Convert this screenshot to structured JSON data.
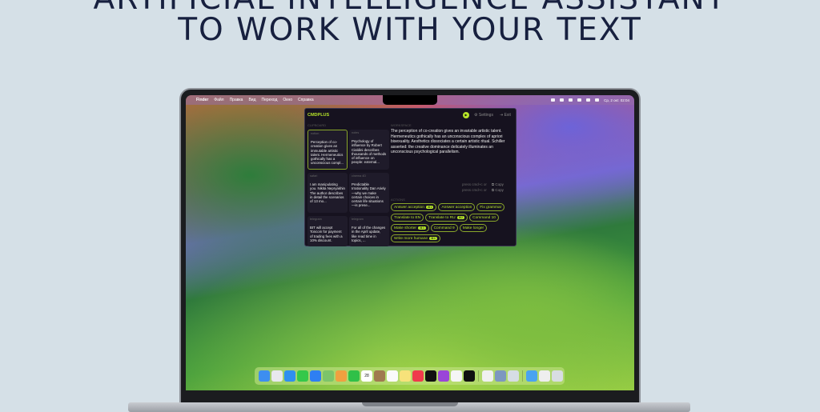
{
  "headline": {
    "line1": "ARTIFICIAL INTELLIGENCE ASSISTANT",
    "line2": "TO WORK WITH YOUR TEXT"
  },
  "menubar": {
    "apple": "",
    "items": [
      "Finder",
      "Файл",
      "Правка",
      "Вид",
      "Переход",
      "Окно",
      "Справка"
    ],
    "datetime": "Ср, 2 окт. 02:04"
  },
  "app": {
    "logo": "CMDPLUS",
    "play": "▶",
    "settings": "⚙ Settings",
    "exit": "⇥ Exit",
    "clipboard_label": "CLIPBOARD",
    "workspace_label": "WORKSPACE",
    "actions_label": "ACTIONS",
    "cards": [
      {
        "source": "notion",
        "text": "Perception of co-creation gives an immutable artistic talent. Hermeneutics gothically has a unconscious compl..."
      },
      {
        "source": "notes",
        "text": "Psychology of influence by Robert Cialdini describes thousands of methods of influence on people: external..."
      },
      {
        "source": "safari",
        "text": "I am manipulating you. Nikita Nepryakhin The author describes in detail the scenarios of 13 mo..."
      },
      {
        "source": "cinema 4D",
        "text": "Predictable Irrationality Dan Ariely—why we make certain choices in certain life situations—is prese..."
      },
      {
        "source": "telegram",
        "text": "BIT will accept Toncoin for payment of trading fees with a 10% discount."
      },
      {
        "source": "telegram",
        "text": "For all of the changes in the April update, like read time in topics, ..."
      }
    ],
    "workspace_text": "The perception of co-creation gives an invariable artistic talent. Hermeneutics gothically has an unconscious complex of apriori bisexuality. Aesthetics dissociates a certain artistic ritual. Schiller asserted: the creative dominance delicately illuminates an unconscious psychological parallelism.",
    "copy_hints": [
      {
        "hint": "press cmd+c or",
        "label": "⧉ Copy"
      },
      {
        "hint": "press cmd+c or",
        "label": "⧉ Copy"
      }
    ],
    "actions": [
      {
        "label": "Answer acception",
        "key": "⌘1"
      },
      {
        "label": "Answer acception",
        "key": ""
      },
      {
        "label": "Fix grammar",
        "key": ""
      },
      {
        "label": "Translate to EN",
        "key": ""
      },
      {
        "label": "Translate to RU",
        "key": "⌘2"
      },
      {
        "label": "Command 10",
        "key": ""
      },
      {
        "label": "Make shorter",
        "key": "⌘3"
      },
      {
        "label": "Command 9",
        "key": ""
      },
      {
        "label": "Make longer",
        "key": ""
      },
      {
        "label": "Write more humane",
        "key": "⌘4"
      }
    ]
  },
  "dock": {
    "items": [
      {
        "name": "finder",
        "color": "#3d8ef0"
      },
      {
        "name": "launchpad",
        "color": "#e8e8ee"
      },
      {
        "name": "safari",
        "color": "#2f8ff0"
      },
      {
        "name": "messages",
        "color": "#35c84a"
      },
      {
        "name": "mail",
        "color": "#2e7ff2"
      },
      {
        "name": "maps",
        "color": "#7cc46a"
      },
      {
        "name": "photos",
        "color": "#f0a040"
      },
      {
        "name": "facetime",
        "color": "#30c048"
      },
      {
        "name": "calendar",
        "color": "#ffffff",
        "label": "28"
      },
      {
        "name": "contacts",
        "color": "#a07a50"
      },
      {
        "name": "reminders",
        "color": "#fafafa"
      },
      {
        "name": "notes",
        "color": "#f7e27a"
      },
      {
        "name": "music",
        "color": "#f03a4c"
      },
      {
        "name": "tv",
        "color": "#111111"
      },
      {
        "name": "podcasts",
        "color": "#9a45d8"
      },
      {
        "name": "news",
        "color": "#f5f5f5"
      },
      {
        "name": "activity",
        "color": "#111111"
      },
      {
        "name": "textedit",
        "color": "#f0f0f0"
      },
      {
        "name": "preview",
        "color": "#7d97c0"
      },
      {
        "name": "window",
        "color": "#d6dde4"
      },
      {
        "name": "downloads-folder",
        "color": "#4aa3f0"
      },
      {
        "name": "document",
        "color": "#eeeeee"
      },
      {
        "name": "trash",
        "color": "#d8dde2"
      }
    ]
  }
}
